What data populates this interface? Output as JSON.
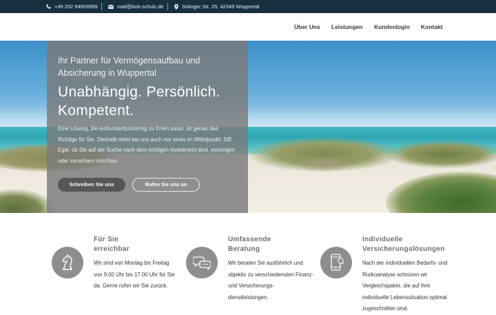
{
  "topbar": {
    "phone": "+49 202 94606999",
    "email": "mail@bvb-schulz.de",
    "address": "Solinger Str. 25, 42349 Wuppertal"
  },
  "nav": {
    "items": [
      "Über Uns",
      "Leistungen",
      "Kundenlogin",
      "Kontakt"
    ]
  },
  "hero": {
    "subtitle": "Ihr Partner für Vermögensaufbau und Absicherung in Wuppertal",
    "title": "Unabhängig. Persönlich. Kompetent.",
    "text": "Eine Lösung, die einhundertprozentig zu Ihnen passt, ist genau das Richtige für Sie. Deshalb steht bei uns auch nur eines im Mittelpunkt: SIE. Egal, ob Sie auf der Suche nach dem richtigen Investment sind, vorsorgen oder versichern möchten.",
    "primary_button": "Schreiben Sie uns",
    "secondary_button": "Rufen Sie uns an"
  },
  "features": [
    {
      "icon": "chess-knight-icon",
      "title_line1": "Für Sie",
      "title_line2": "erreichbar",
      "text": "Wir sind von Montag bis Freitag von 9.00 Uhr bis 17.00 Uhr für Sie da. Gerne rufen wir Sie zurück."
    },
    {
      "icon": "chat-bubbles-icon",
      "title_line1": "Umfassende",
      "title_line2": "Beratung",
      "text": "Wir beraten Sie ausführlich und objektiv zu verschiedensten Finanz- und Versicherungs-dienstleistungen."
    },
    {
      "icon": "smartphone-icon",
      "title_line1": "Individuelle",
      "title_line2": "Versicherungslösungen",
      "text": "Nach der individuellen Bedarfs- und Risikoanalyse schnüren wir Vergleichspakte, die auf Ihre individuelle Lebenssituation optimal zugeschnitten sind."
    }
  ],
  "colors": {
    "topbar": "#17303f",
    "feature_circle": "#8e8e8e",
    "primary_button": "#565656"
  }
}
